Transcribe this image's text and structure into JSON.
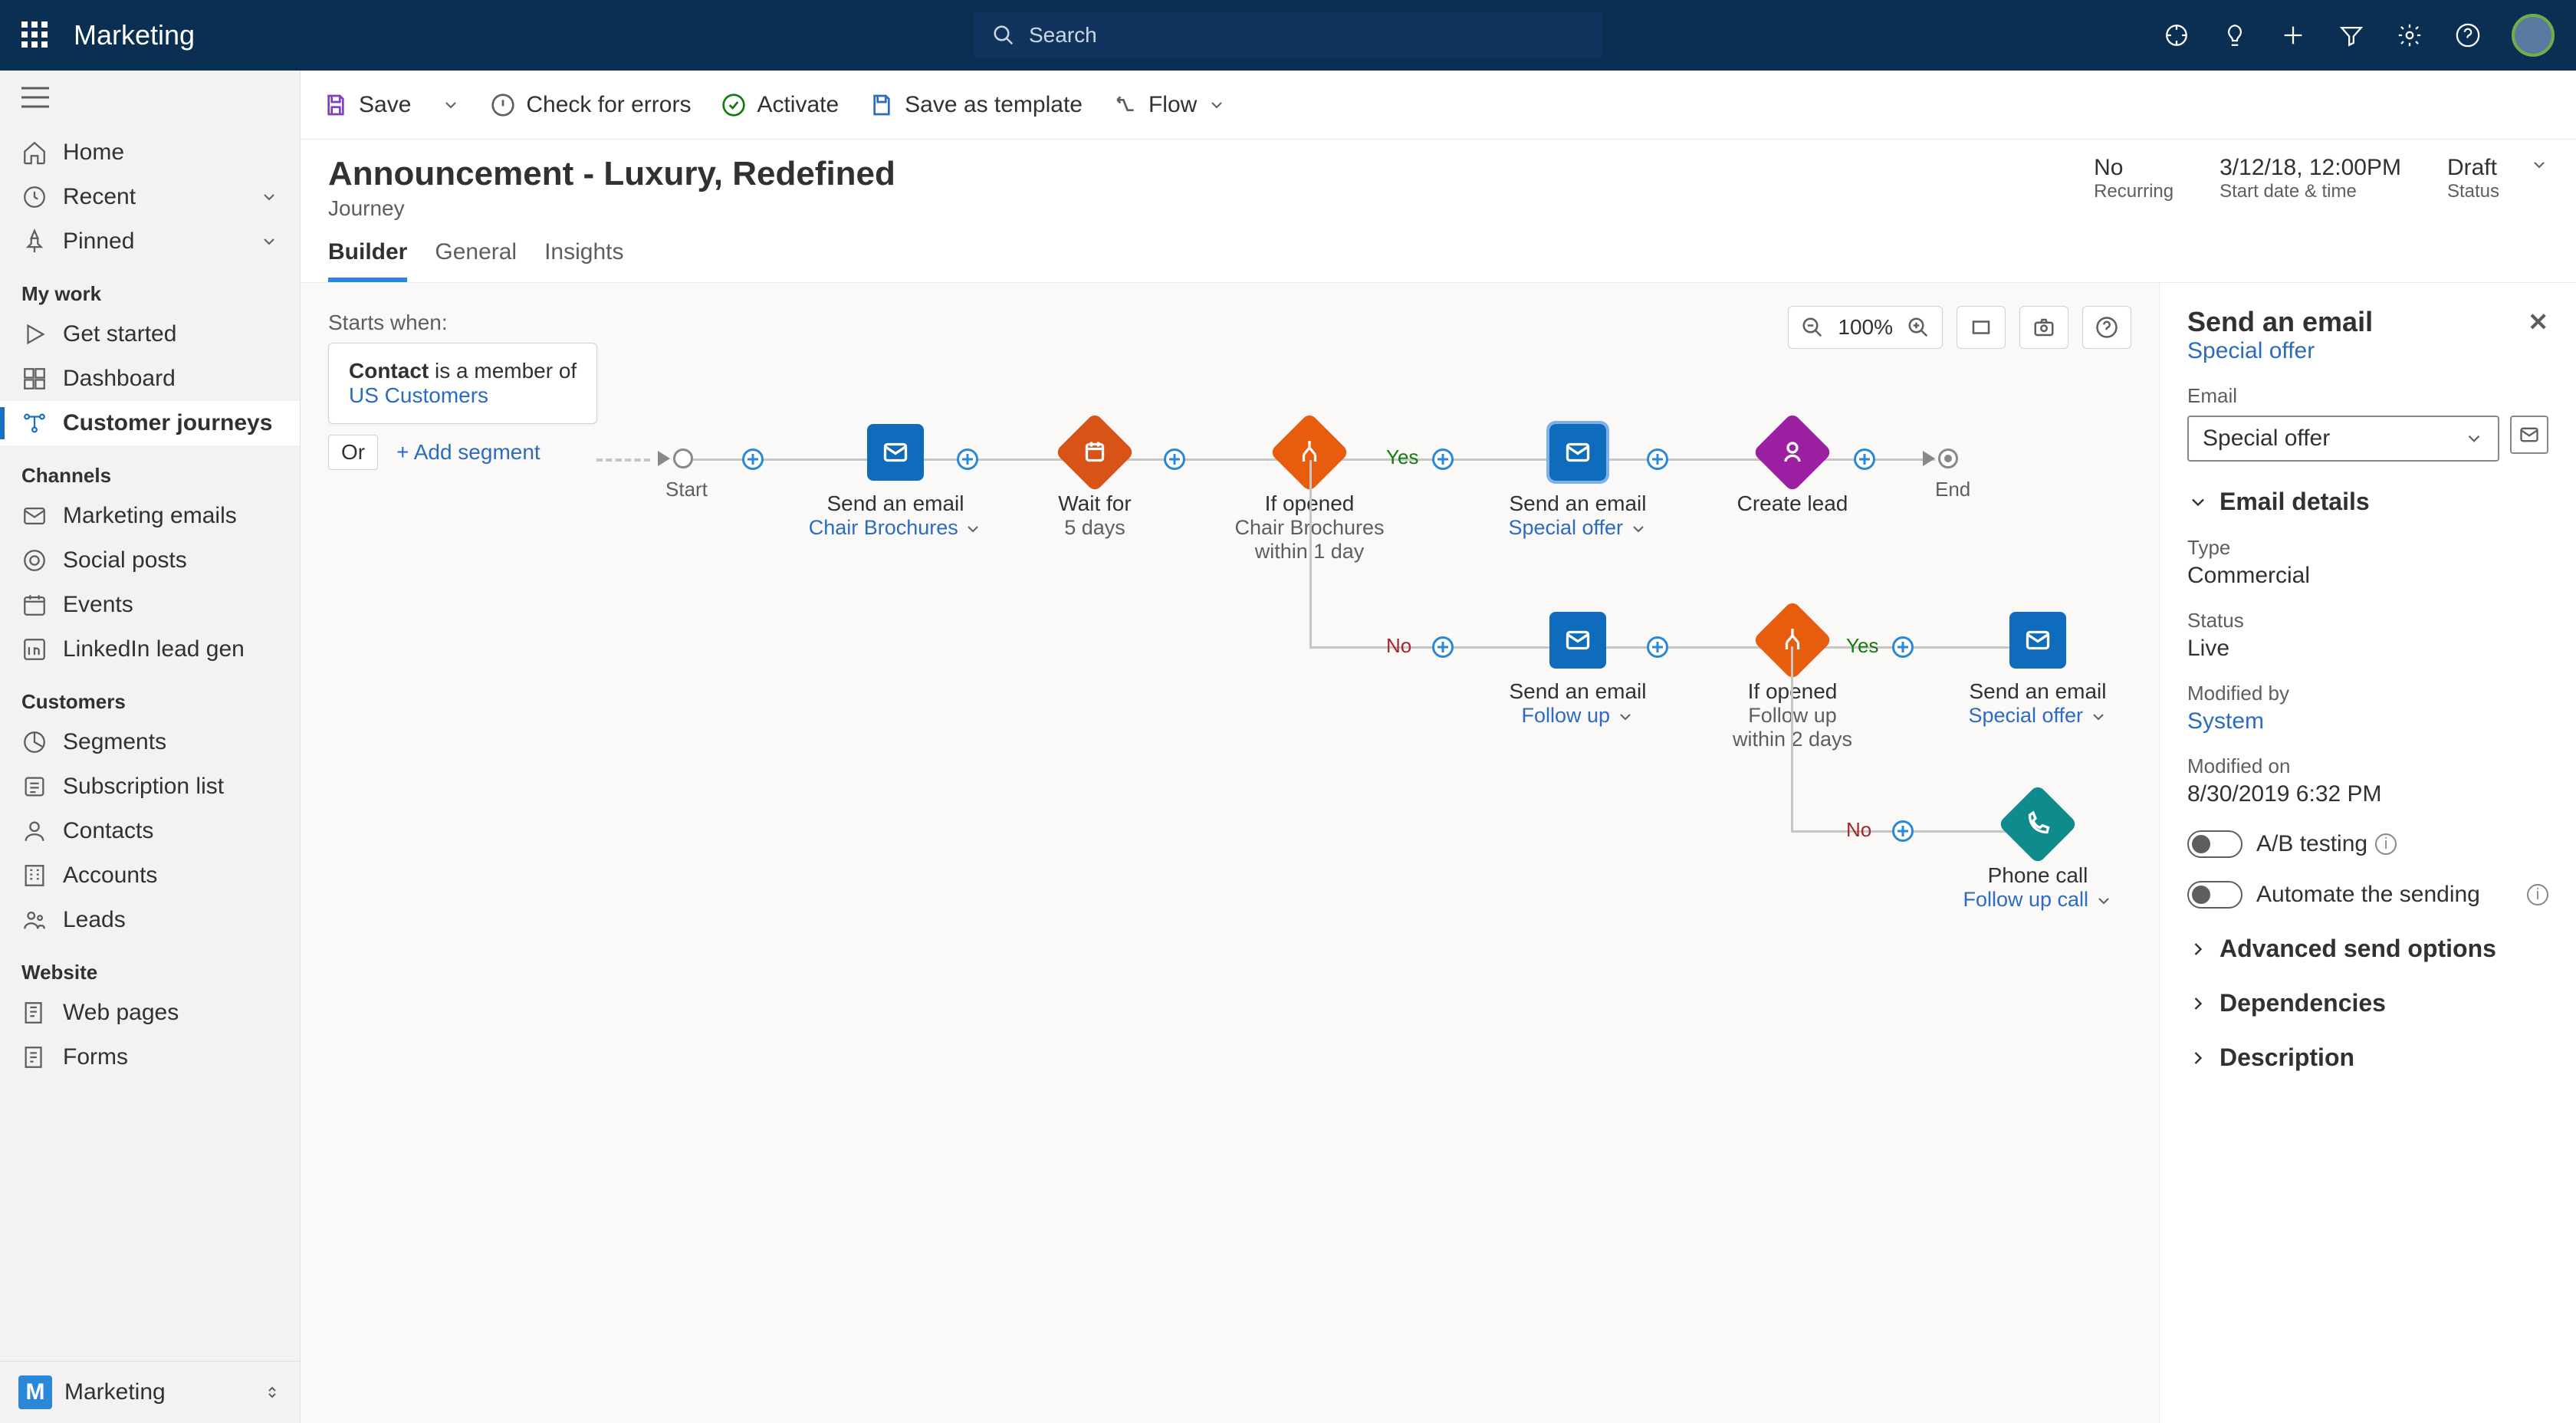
{
  "app_name": "Marketing",
  "search_placeholder": "Search",
  "nav": {
    "home": "Home",
    "recent": "Recent",
    "pinned": "Pinned",
    "mywork": "My work",
    "get_started": "Get started",
    "dashboard": "Dashboard",
    "journeys": "Customer journeys",
    "channels": "Channels",
    "emails": "Marketing emails",
    "social": "Social posts",
    "events": "Events",
    "linkedin": "LinkedIn lead gen",
    "customers": "Customers",
    "segments": "Segments",
    "subs": "Subscription list",
    "contacts": "Contacts",
    "accounts": "Accounts",
    "leads": "Leads",
    "website": "Website",
    "webpages": "Web pages",
    "forms": "Forms",
    "footer_badge": "M",
    "footer_label": "Marketing"
  },
  "cmd": {
    "save": "Save",
    "check": "Check for errors",
    "activate": "Activate",
    "saveas": "Save as template",
    "flow": "Flow"
  },
  "page": {
    "title": "Announcement - Luxury, Redefined",
    "subtitle": "Journey",
    "recurring_val": "No",
    "recurring_lbl": "Recurring",
    "start_val": "3/12/18, 12:00PM",
    "start_lbl": "Start date & time",
    "status_val": "Draft",
    "status_lbl": "Status"
  },
  "tabs": {
    "builder": "Builder",
    "general": "General",
    "insights": "Insights"
  },
  "canvas": {
    "zoom": "100%",
    "starts_label": "Starts when:",
    "seg_prefix": "Contact",
    "seg_mid": " is a member of ",
    "seg_link": "US Customers",
    "or": "Or",
    "add_segment": "+ Add segment",
    "start": "Start",
    "end": "End",
    "send_email": "Send an email",
    "chair_brochures": "Chair Brochures",
    "wait_for": "Wait for",
    "five_days": "5 days",
    "if_opened": "If opened",
    "within1": "within 1 day",
    "within2": "within 2 days",
    "special_offer": "Special offer",
    "create_lead": "Create lead",
    "follow_up": "Follow up",
    "phone_call": "Phone call",
    "follow_up_call": "Follow up call",
    "yes": "Yes",
    "no": "No"
  },
  "panel": {
    "title": "Send an email",
    "link": "Special offer",
    "email_lbl": "Email",
    "email_val": "Special offer",
    "details": "Email details",
    "type_lbl": "Type",
    "type_val": "Commercial",
    "status_lbl": "Status",
    "status_val": "Live",
    "modby_lbl": "Modified by",
    "modby_val": "System",
    "modon_lbl": "Modified on",
    "modon_val": "8/30/2019  6:32 PM",
    "ab": "A/B testing",
    "auto": "Automate the sending",
    "adv": "Advanced send options",
    "deps": "Dependencies",
    "desc": "Description"
  }
}
